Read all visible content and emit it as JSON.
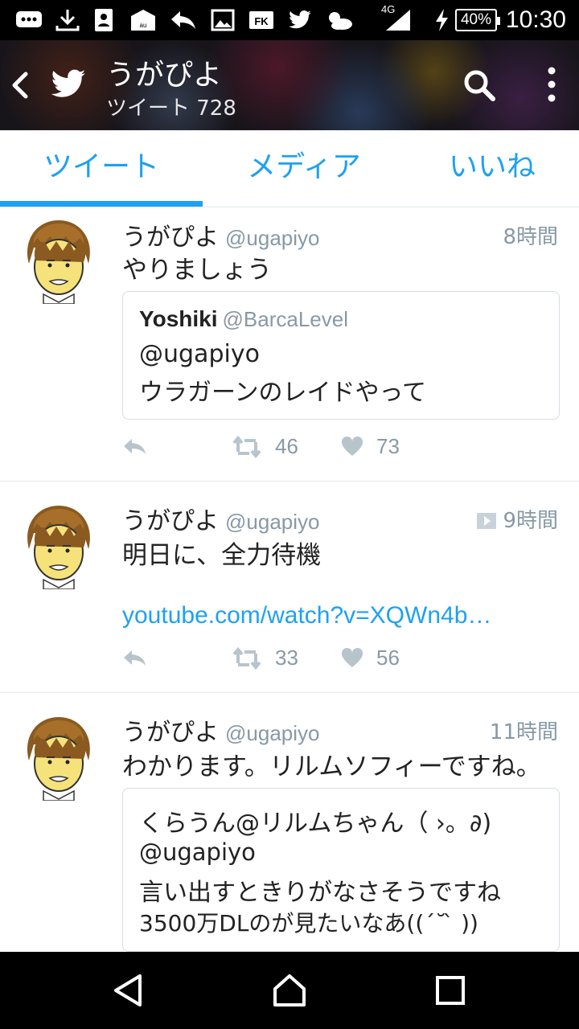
{
  "status_bar": {
    "battery": "40%",
    "network": "4G",
    "time": "10:30",
    "icons": [
      "chat-icon",
      "download-icon",
      "contact-icon",
      "au-mail-icon",
      "reply-icon",
      "image-icon",
      "fk-icon",
      "twitter-icon",
      "weather-icon"
    ]
  },
  "header": {
    "name": "うがぴよ",
    "tweet_count": "ツイート 728"
  },
  "tabs": [
    {
      "label": "ツイート",
      "active": true
    },
    {
      "label": "メディア",
      "active": false
    },
    {
      "label": "いいね",
      "active": false
    }
  ],
  "tweets": [
    {
      "name": "うがぴよ",
      "handle": "@ugapiyo",
      "time": "8時間",
      "text": "やりましょう",
      "quote": {
        "name": "Yoshiki",
        "handle": "@BarcaLevel",
        "lines": [
          "@ugapiyo",
          "ウラガーンのレイドやって"
        ]
      },
      "retweets": "46",
      "likes": "73"
    },
    {
      "name": "うがぴよ",
      "handle": "@ugapiyo",
      "time": "9時間",
      "text": "明日に、全力待機",
      "link": "youtube.com/watch?v=XQWn4b…",
      "retweets": "33",
      "likes": "56"
    },
    {
      "name": "うがぴよ",
      "handle": "@ugapiyo",
      "time": "11時間",
      "text": "わかります。リルムソフィーですね。",
      "quote": {
        "name": "くらうん@リルムちゃん（ ›。∂)",
        "lines": [
          "@ugapiyo",
          "言い出すときりがなさそうですね",
          "3500万DLのが見たいなあ((´˘ ̀ ))"
        ]
      }
    }
  ],
  "colors": {
    "accent": "#1da1f2",
    "secondary_text": "#8899a6",
    "divider": "#e1e8ed"
  }
}
